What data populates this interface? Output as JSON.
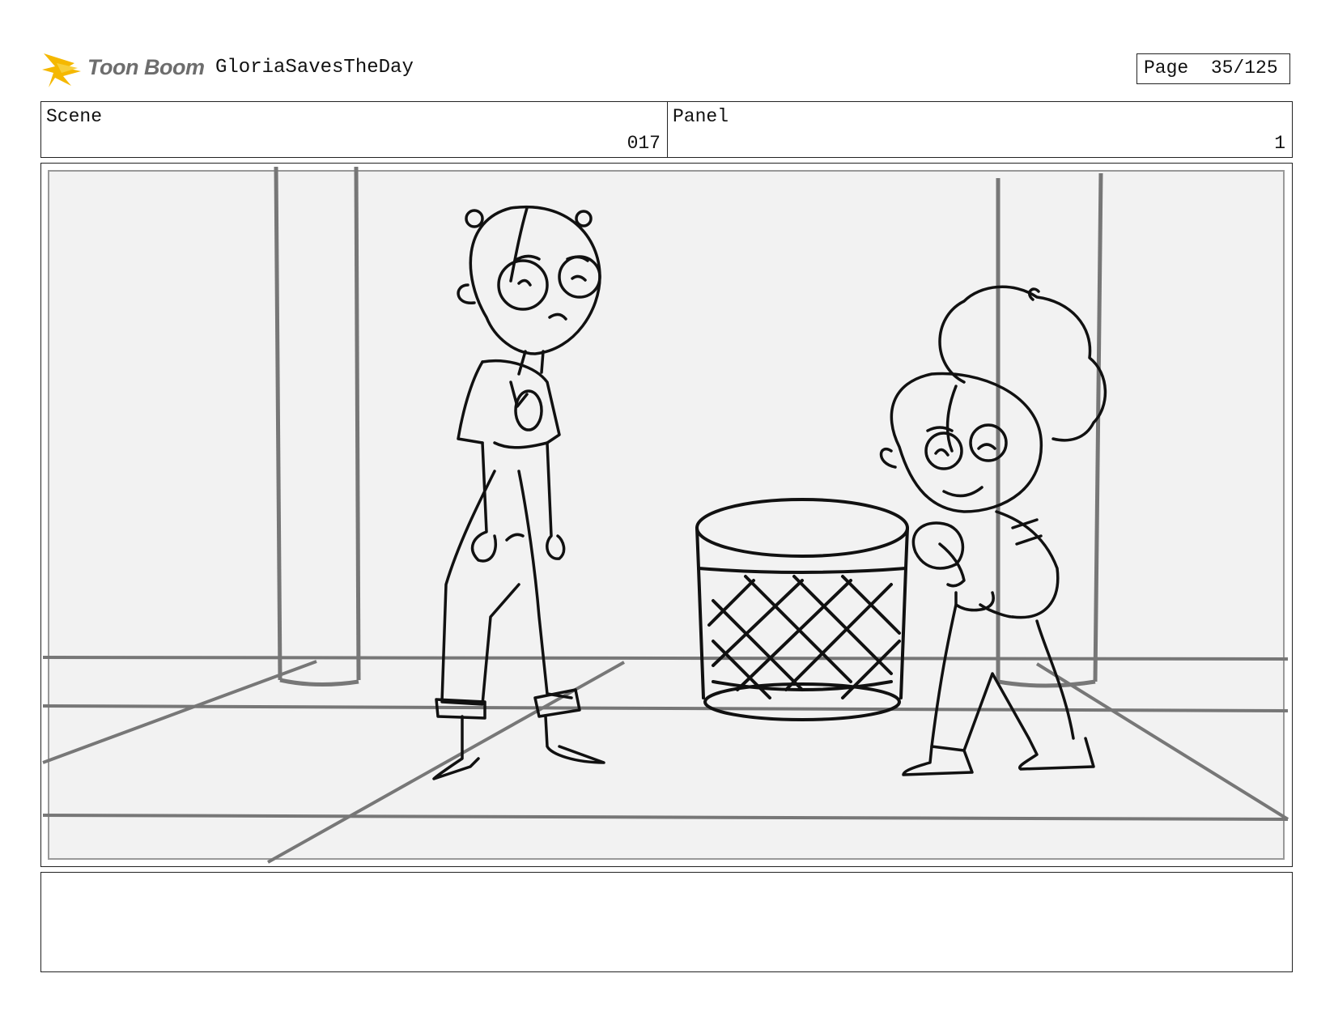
{
  "header": {
    "brand": "Toon Boom",
    "project_title": "GloriaSavesTheDay",
    "page_label": "Page",
    "page_value": "35/125"
  },
  "scene": {
    "label": "Scene",
    "value": "017"
  },
  "panel": {
    "label": "Panel",
    "value": "1"
  },
  "notes": {
    "text": ""
  },
  "colors": {
    "logo_accent": "#f5b800",
    "frame_line": "#222222",
    "background_fill": "#f2f2f2"
  }
}
